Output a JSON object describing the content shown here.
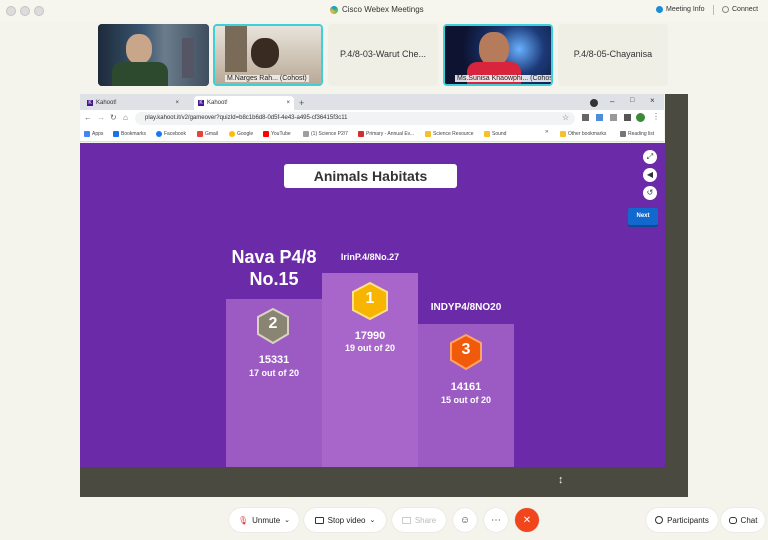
{
  "window": {
    "title": "Cisco Webex Meetings",
    "meeting_info": "Meeting Info",
    "connect_label": "Connect"
  },
  "participants": [
    {
      "name": "",
      "type": "video"
    },
    {
      "name": "M.Narges Rah...",
      "role": "(Cohost)",
      "type": "video"
    },
    {
      "name": "P.4/8-03-Warut Che...",
      "type": "name"
    },
    {
      "name": "Ms.Sunisa Khaowphi...",
      "role": "(Cohost)",
      "type": "video"
    },
    {
      "name": "P.4/8-05-Chayanisa",
      "type": "name"
    }
  ],
  "browser": {
    "tabs": [
      {
        "label": "Kahoot!"
      },
      {
        "label": "Kahoot!"
      }
    ],
    "url": "play.kahoot.it/v2/gameover?quizId=b8c1b6d8-0d5f-4e43-a495-cf36415f3c11",
    "bookmarks": [
      {
        "label": "Apps",
        "color": "#4285f4"
      },
      {
        "label": "Bookmarks",
        "color": "#1a73e8"
      },
      {
        "label": "Facebook",
        "color": "#1877f2"
      },
      {
        "label": "Gmail",
        "color": "#ea4335"
      },
      {
        "label": "Google",
        "color": "#fbbc05"
      },
      {
        "label": "YouTube",
        "color": "#ff0000"
      },
      {
        "label": "(1) Science P2/7",
        "color": "#9e9e9e"
      },
      {
        "label": "Primary - Annual Ev...",
        "color": "#d32f2f"
      },
      {
        "label": "Science Resource",
        "color": "#f6c026"
      },
      {
        "label": "Sound",
        "color": "#f6c026"
      },
      {
        "label": "Other bookmarks",
        "color": "#f6c026"
      },
      {
        "label": "Reading list",
        "color": "#757575"
      }
    ]
  },
  "kahoot": {
    "title": "Animals Habitats",
    "next_label": "Next",
    "podium": [
      {
        "rank": "1",
        "name": "IrinP.4/8No.27",
        "score": "17990",
        "correct": "19 out of 20",
        "badge_color": "#f7b500"
      },
      {
        "rank": "2",
        "name": "Nava P4/8 No.15",
        "score": "15331",
        "correct": "17 out of 20",
        "badge_color": "#8a8473"
      },
      {
        "rank": "3",
        "name": "INDYP4/8NO20",
        "score": "14161",
        "correct": "15 out of 20",
        "badge_color": "#f15a0b"
      }
    ]
  },
  "toolbar": {
    "unmute_label": "Unmute",
    "stop_video_label": "Stop video",
    "share_label": "Share",
    "participants_label": "Participants",
    "chat_label": "Chat"
  },
  "colors": {
    "kahoot_purple": "#6b2aa8",
    "podium": "#9b5bc3",
    "end_call": "#f1451c",
    "next_blue": "#1368ce"
  }
}
